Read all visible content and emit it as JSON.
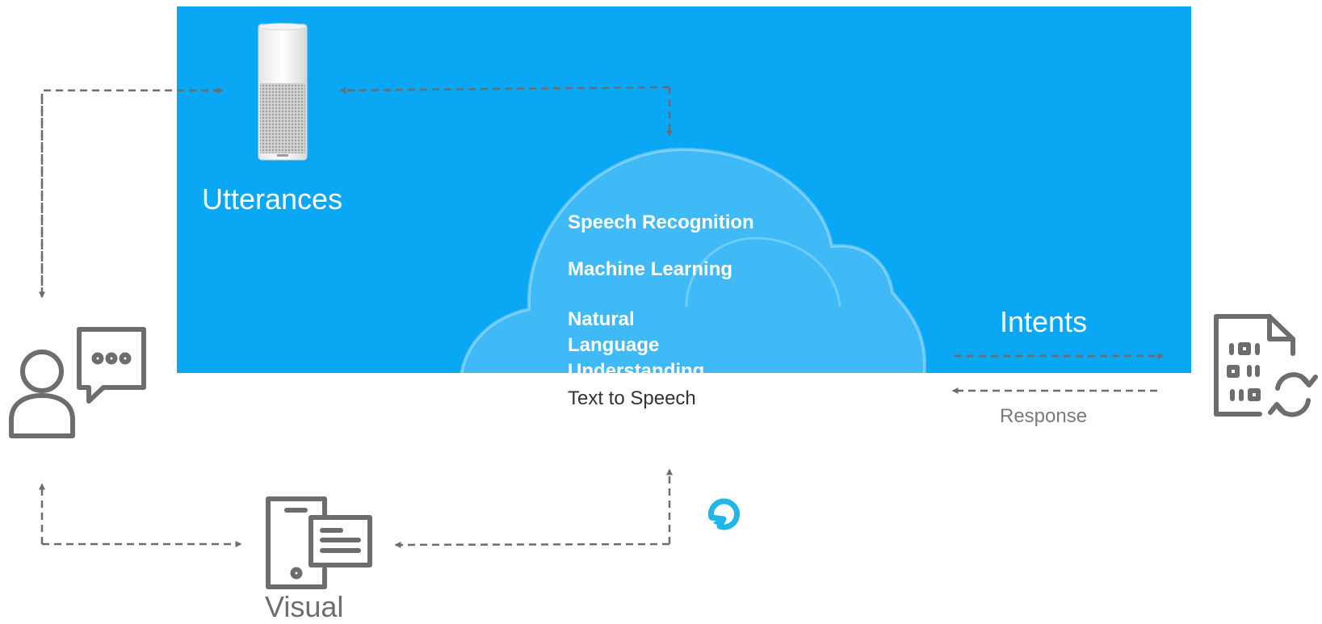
{
  "device": {
    "label": "Utterances"
  },
  "cloud": {
    "items": [
      "Speech Recognition",
      "Machine Learning",
      "Natural Language\nUnderstanding",
      "Text to Speech"
    ]
  },
  "flows": {
    "intents_label": "Intents",
    "response_label": "Response"
  },
  "visual": {
    "label": "Visual"
  },
  "colors": {
    "panel": "#0aa7f5",
    "arrow": "#6d6d6d",
    "icon": "#6d6d6d",
    "alexa_ring": "#1fb6ea",
    "label_dark": "#444444"
  }
}
